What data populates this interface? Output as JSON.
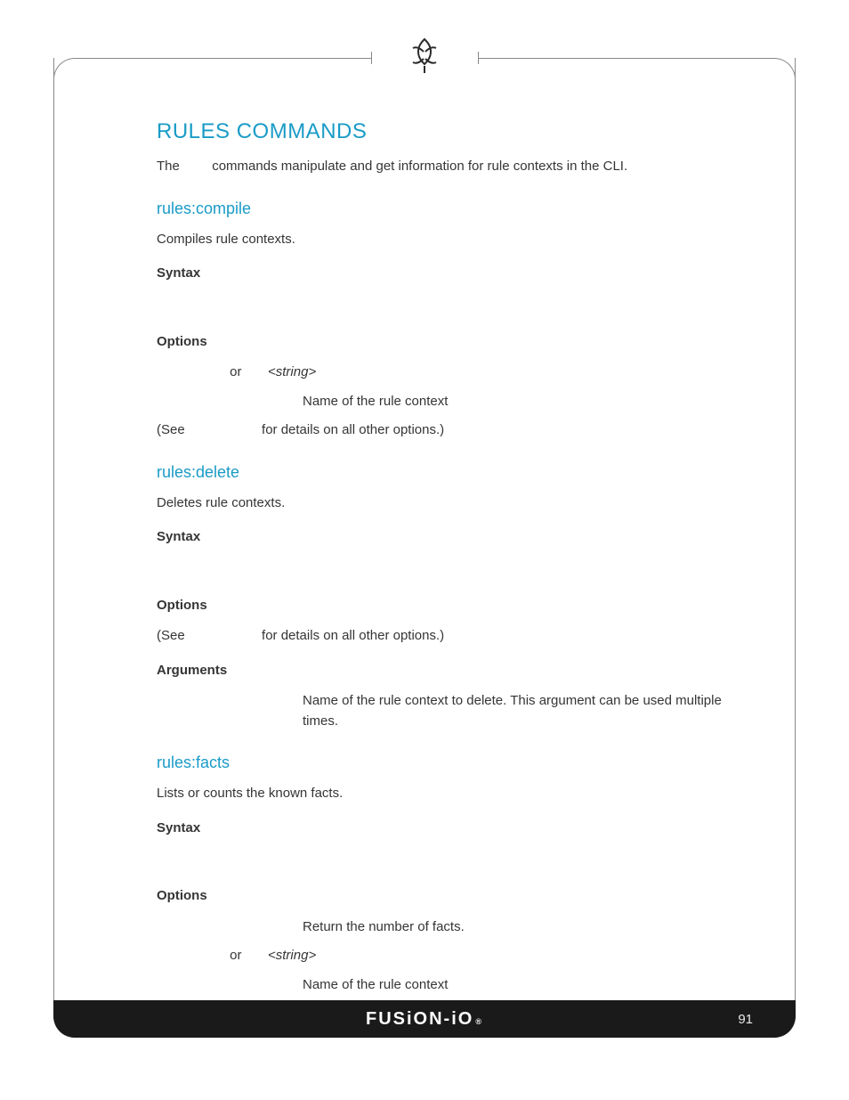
{
  "page_number": "91",
  "footer_logo": "FUSiON-iO",
  "footer_reg": "®",
  "h1": "RULES COMMANDS",
  "intro_the": "The",
  "intro_rest": "commands manipulate and get information for rule contexts in the CLI.",
  "sections": {
    "compile": {
      "title": "rules:compile",
      "desc": "Compiles rule contexts.",
      "syntax_label": "Syntax",
      "options_label": "Options",
      "opt_or": "or",
      "opt_arg": "<string>",
      "opt_desc": "Name of the rule context",
      "see_pre": "(See",
      "see_post": "for details on all other options.)"
    },
    "delete": {
      "title": "rules:delete",
      "desc": "Deletes rule contexts.",
      "syntax_label": "Syntax",
      "options_label": "Options",
      "see_pre": "(See",
      "see_post": "for details on all other options.)",
      "args_label": "Arguments",
      "arg_desc": "Name of the rule context to delete. This argument can be used multiple times."
    },
    "facts": {
      "title": "rules:facts",
      "desc": "Lists or counts the known facts.",
      "syntax_label": "Syntax",
      "options_label": "Options",
      "opt1_desc": "Return the number of facts.",
      "opt2_or": "or",
      "opt2_arg": "<string>",
      "opt2_desc": "Name of the rule context"
    }
  }
}
